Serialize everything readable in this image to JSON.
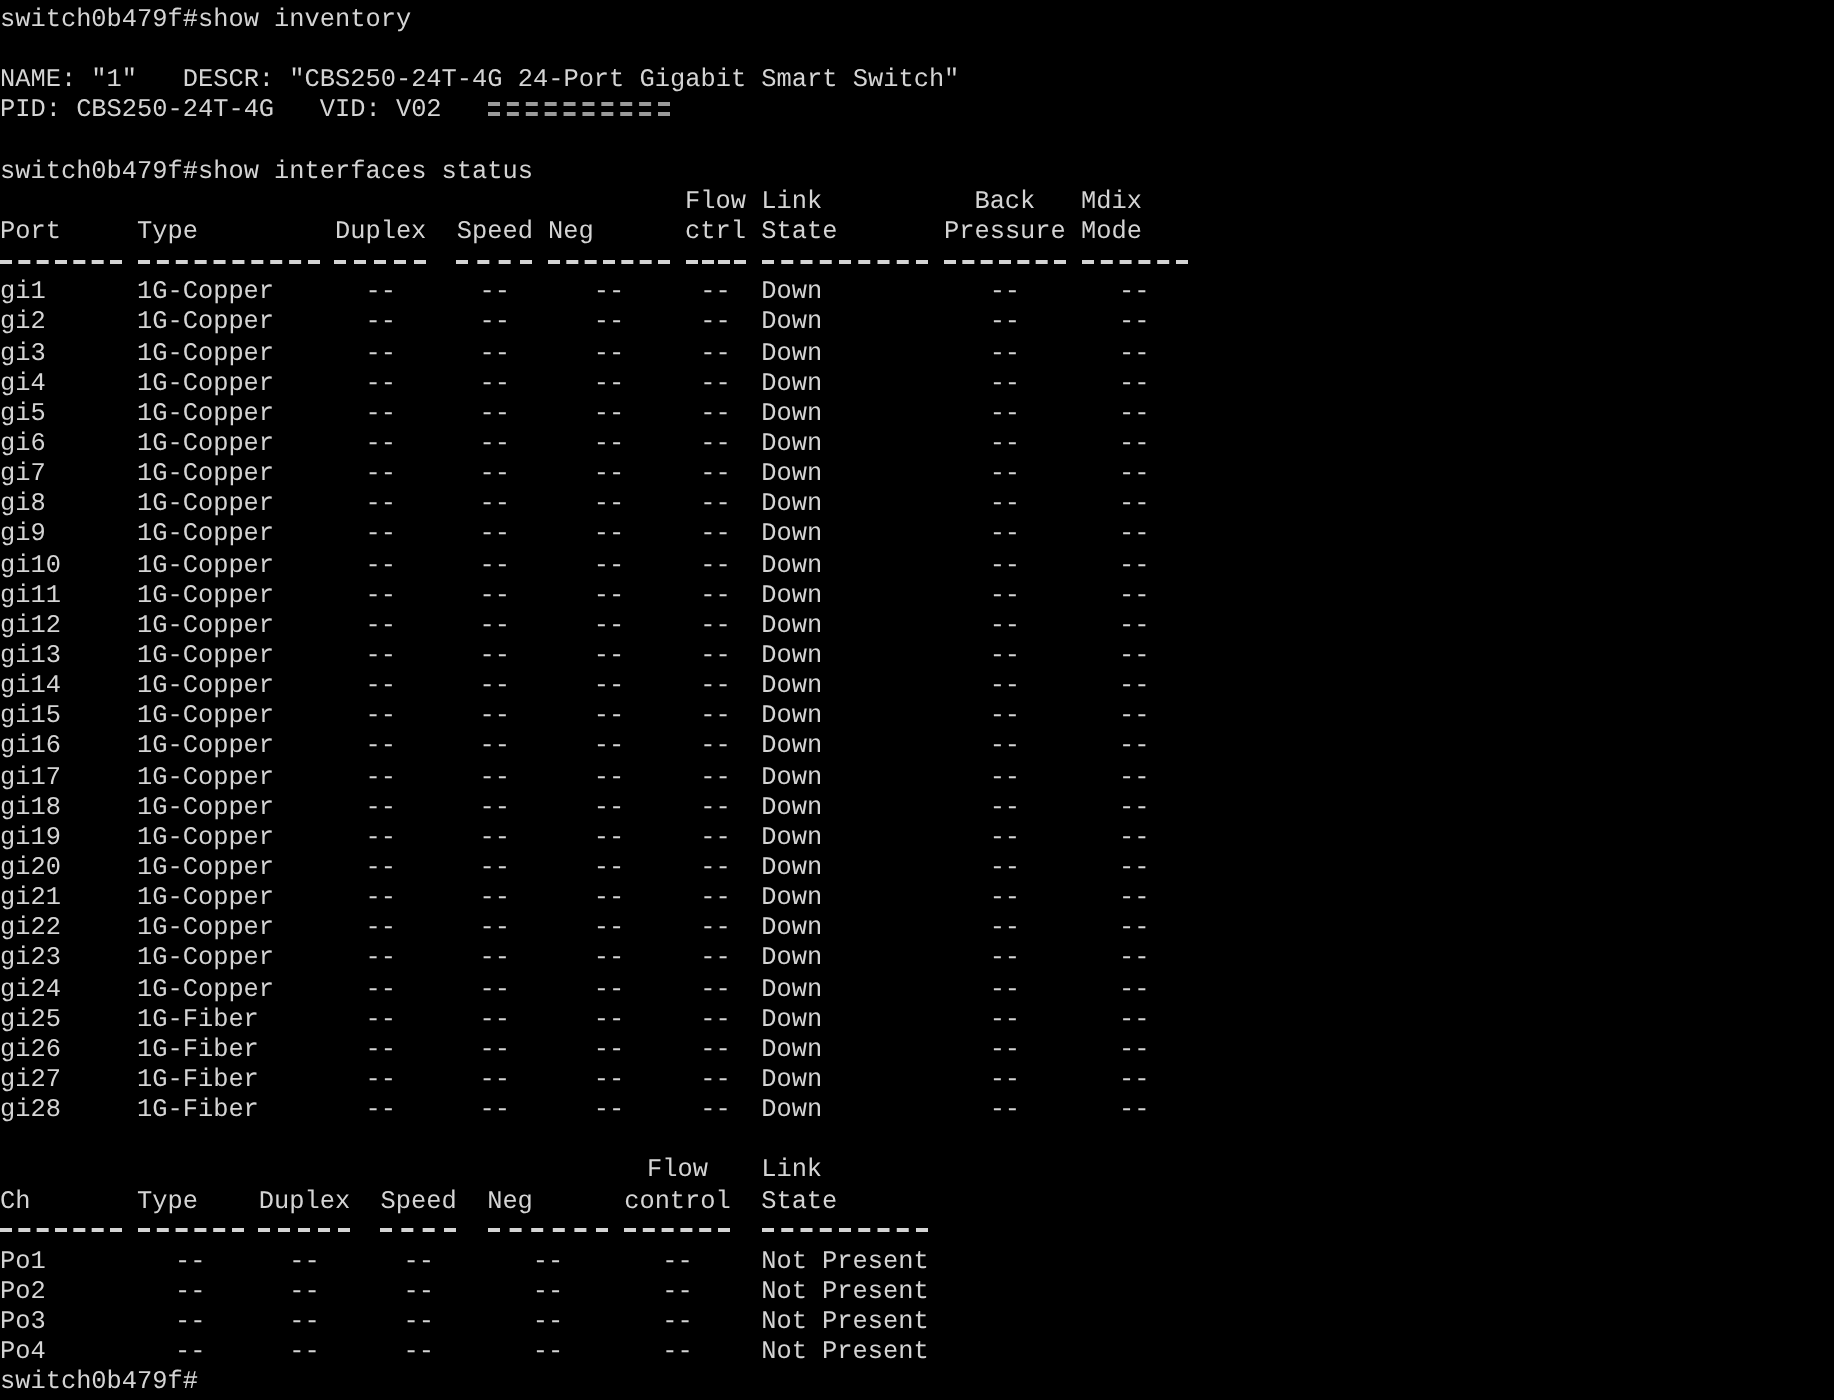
{
  "lines": [
    {
      "kind": "text",
      "text": "switch0b479f#show inventory"
    },
    {
      "kind": "blank"
    },
    {
      "kind": "text",
      "text": "NAME: \"1\"   DESCR: \"CBS250-24T-4G 24-Port Gigabit Smart Switch\""
    },
    {
      "kind": "text",
      "text": "PID: CBS250-24T-4G   VID: V02",
      "redacted": true
    },
    {
      "kind": "blank"
    },
    {
      "kind": "text",
      "text": "switch0b479f#show interfaces status"
    },
    {
      "kind": "table",
      "columns": [
        {
          "lines": [
            "Port"
          ]
        },
        {
          "lines": [
            "Type"
          ]
        },
        {
          "lines": [
            "Duplex"
          ]
        },
        {
          "lines": [
            "Speed"
          ]
        },
        {
          "lines": [
            "Neg"
          ]
        },
        {
          "lines": [
            "Flow",
            "ctrl"
          ]
        },
        {
          "lines": [
            "Link",
            "State"
          ]
        },
        {
          "lines": [
            "Back",
            "Pressure"
          ]
        },
        {
          "lines": [
            "Mdix",
            "Mode"
          ]
        }
      ],
      "rows": [
        [
          "gi1",
          "1G-Copper",
          "--",
          "--",
          "--",
          "--",
          "Down",
          "--",
          "--"
        ],
        [
          "gi2",
          "1G-Copper",
          "--",
          "--",
          "--",
          "--",
          "Down",
          "--",
          "--"
        ],
        [
          "gi3",
          "1G-Copper",
          "--",
          "--",
          "--",
          "--",
          "Down",
          "--",
          "--"
        ],
        [
          "gi4",
          "1G-Copper",
          "--",
          "--",
          "--",
          "--",
          "Down",
          "--",
          "--"
        ],
        [
          "gi5",
          "1G-Copper",
          "--",
          "--",
          "--",
          "--",
          "Down",
          "--",
          "--"
        ],
        [
          "gi6",
          "1G-Copper",
          "--",
          "--",
          "--",
          "--",
          "Down",
          "--",
          "--"
        ],
        [
          "gi7",
          "1G-Copper",
          "--",
          "--",
          "--",
          "--",
          "Down",
          "--",
          "--"
        ],
        [
          "gi8",
          "1G-Copper",
          "--",
          "--",
          "--",
          "--",
          "Down",
          "--",
          "--"
        ],
        [
          "gi9",
          "1G-Copper",
          "--",
          "--",
          "--",
          "--",
          "Down",
          "--",
          "--"
        ],
        [
          "gi10",
          "1G-Copper",
          "--",
          "--",
          "--",
          "--",
          "Down",
          "--",
          "--"
        ],
        [
          "gi11",
          "1G-Copper",
          "--",
          "--",
          "--",
          "--",
          "Down",
          "--",
          "--"
        ],
        [
          "gi12",
          "1G-Copper",
          "--",
          "--",
          "--",
          "--",
          "Down",
          "--",
          "--"
        ],
        [
          "gi13",
          "1G-Copper",
          "--",
          "--",
          "--",
          "--",
          "Down",
          "--",
          "--"
        ],
        [
          "gi14",
          "1G-Copper",
          "--",
          "--",
          "--",
          "--",
          "Down",
          "--",
          "--"
        ],
        [
          "gi15",
          "1G-Copper",
          "--",
          "--",
          "--",
          "--",
          "Down",
          "--",
          "--"
        ],
        [
          "gi16",
          "1G-Copper",
          "--",
          "--",
          "--",
          "--",
          "Down",
          "--",
          "--"
        ],
        [
          "gi17",
          "1G-Copper",
          "--",
          "--",
          "--",
          "--",
          "Down",
          "--",
          "--"
        ],
        [
          "gi18",
          "1G-Copper",
          "--",
          "--",
          "--",
          "--",
          "Down",
          "--",
          "--"
        ],
        [
          "gi19",
          "1G-Copper",
          "--",
          "--",
          "--",
          "--",
          "Down",
          "--",
          "--"
        ],
        [
          "gi20",
          "1G-Copper",
          "--",
          "--",
          "--",
          "--",
          "Down",
          "--",
          "--"
        ],
        [
          "gi21",
          "1G-Copper",
          "--",
          "--",
          "--",
          "--",
          "Down",
          "--",
          "--"
        ],
        [
          "gi22",
          "1G-Copper",
          "--",
          "--",
          "--",
          "--",
          "Down",
          "--",
          "--"
        ],
        [
          "gi23",
          "1G-Copper",
          "--",
          "--",
          "--",
          "--",
          "Down",
          "--",
          "--"
        ],
        [
          "gi24",
          "1G-Copper",
          "--",
          "--",
          "--",
          "--",
          "Down",
          "--",
          "--"
        ],
        [
          "gi25",
          "1G-Fiber",
          "--",
          "--",
          "--",
          "--",
          "Down",
          "--",
          "--"
        ],
        [
          "gi26",
          "1G-Fiber",
          "--",
          "--",
          "--",
          "--",
          "Down",
          "--",
          "--"
        ],
        [
          "gi27",
          "1G-Fiber",
          "--",
          "--",
          "--",
          "--",
          "Down",
          "--",
          "--"
        ],
        [
          "gi28",
          "1G-Fiber",
          "--",
          "--",
          "--",
          "--",
          "Down",
          "--",
          "--"
        ]
      ]
    },
    {
      "kind": "blank"
    },
    {
      "kind": "table",
      "columns": [
        {
          "lines": [
            "Ch"
          ]
        },
        {
          "lines": [
            "Type"
          ]
        },
        {
          "lines": [
            "Duplex"
          ]
        },
        {
          "lines": [
            "Speed"
          ]
        },
        {
          "lines": [
            "Neg"
          ]
        },
        {
          "lines": [
            "Flow",
            "control"
          ]
        },
        {
          "lines": [
            "Link",
            "State"
          ]
        }
      ],
      "rows": [
        [
          "Po1",
          "--",
          "--",
          "--",
          "--",
          "--",
          "Not Present"
        ],
        [
          "Po2",
          "--",
          "--",
          "--",
          "--",
          "--",
          "Not Present"
        ],
        [
          "Po3",
          "--",
          "--",
          "--",
          "--",
          "--",
          "Not Present"
        ],
        [
          "Po4",
          "--",
          "--",
          "--",
          "--",
          "--",
          "Not Present"
        ]
      ]
    },
    {
      "kind": "text",
      "text": "switch0b479f#"
    }
  ]
}
